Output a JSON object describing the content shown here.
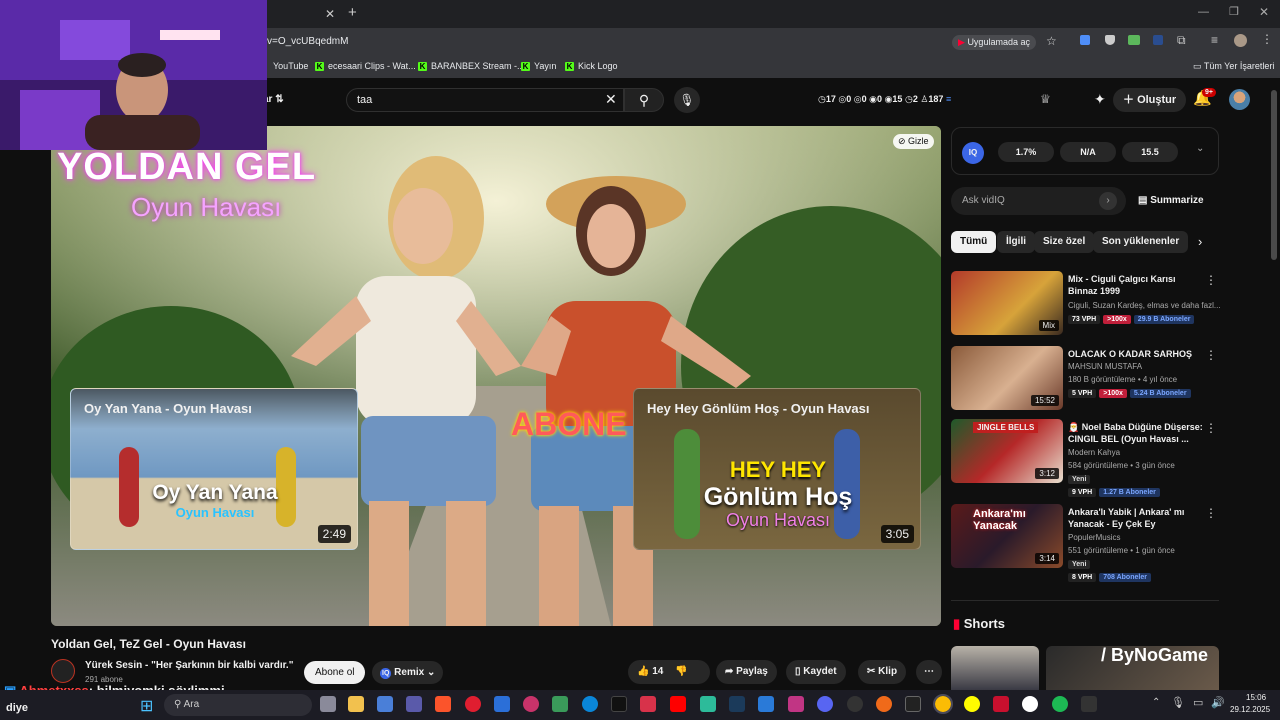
{
  "browser": {
    "url_fragment": "v=O_vcUBqedmM",
    "open_app_label": "Uygulamada aç",
    "bookmarks": [
      "YouTube",
      "ecesaari Clips - Wat...",
      "BARANBEX Stream -...",
      "Yayın",
      "Kick Logo"
    ],
    "all_bookmarks_label": "Tüm Yer İşaretleri"
  },
  "youtube": {
    "filter_label": "ar",
    "search_value": "taa",
    "stats": [
      {
        "icon": "clock",
        "value": "17"
      },
      {
        "icon": "circle",
        "value": "0"
      },
      {
        "icon": "circle",
        "value": "0"
      },
      {
        "icon": "eye",
        "value": "0"
      },
      {
        "icon": "eye",
        "value": "15"
      },
      {
        "icon": "clock",
        "value": "2"
      },
      {
        "icon": "person",
        "value": "187"
      }
    ],
    "create_label": "Oluştur",
    "notif_badge": "9+"
  },
  "video": {
    "hide_label": "Gizle",
    "overlay_title": "YOLDAN GEL",
    "overlay_subtitle": "Oyun Havası",
    "abone_text": "ABONE",
    "endcard_left": {
      "title": "Oy Yan Yana - Oyun Havası",
      "big1": "Oy Yan Yana",
      "big2": "Oyun Havası",
      "duration": "2:49"
    },
    "endcard_right": {
      "title": "Hey Hey Gönlüm Hoş - Oyun Havası",
      "big1": "HEY HEY",
      "big2": "Gönlüm Hoş",
      "big3": "Oyun Havası",
      "duration": "3:05"
    },
    "title": "Yoldan Gel, TeZ Gel - Oyun Havası",
    "channel": "Yürek Sesin - \"Her Şarkının bir kalbi vardır.\"",
    "subscribers": "291 abone",
    "subscribe_label": "Abone ol",
    "remix_label": "Remix",
    "likes": "14",
    "share_label": "Paylaş",
    "save_label": "Kaydet",
    "clip_label": "Klip"
  },
  "vidiq": {
    "logo": "IQ",
    "stat1": "1.7%",
    "stat2": "N/A",
    "stat3": "15.5",
    "ask_placeholder": "Ask vidIQ",
    "summarize_label": "Summarize"
  },
  "chips": [
    "Tümü",
    "İlgili",
    "Size özel",
    "Son yüklenenler"
  ],
  "related": [
    {
      "title": "Mix - Ciguli  Çalgıcı Karısı Binnaz 1999",
      "line1": "Ciguli, Suzan Kardeş, elmas ve daha fazl...",
      "line2": "",
      "badges": [
        "73 VPH",
        ">100x",
        "29.9 B Aboneler"
      ],
      "thumb_label": "Mix",
      "new": ""
    },
    {
      "title": "OLACAK O KADAR SARHOŞ",
      "line1": "MAHSUN MUSTAFA",
      "line2": "180 B görüntüleme • 4 yıl önce",
      "badges": [
        "5 VPH",
        ">100x",
        "5.24 B Aboneler"
      ],
      "thumb_label": "15:52",
      "new": ""
    },
    {
      "title": "🎅 Noel Baba Düğüne Düşerse: CINGIL BEL (Oyun Havası ...",
      "line1": "Modern Kahya",
      "line2": "584 görüntüleme • 3 gün önce",
      "badges": [
        "9 VPH",
        "1.27 B Aboneler"
      ],
      "thumb_label": "3:12",
      "new": "Yeni",
      "thumb_text": "JINGLE BELLS"
    },
    {
      "title": "Ankara'lı Yabik | Ankara' mı Yanacak - Ey Çek Ey",
      "line1": "PopulerMusics",
      "line2": "551 görüntüleme • 1 gün önce",
      "badges": [
        "8 VPH",
        "708 Aboneler"
      ],
      "thumb_label": "3:14",
      "new": "Yeni",
      "thumb_text": "Ankara'mı Yanacak"
    }
  ],
  "shorts_label": "Shorts",
  "shorts_overlay": "ByNoGame",
  "chat": {
    "user": "Ahmetxxss",
    "message": ": bilmiyomki söylimmi",
    "lower": "diye"
  },
  "taskbar": {
    "search_placeholder": "Ara",
    "time": "15:06",
    "date": "29.12.2025"
  }
}
